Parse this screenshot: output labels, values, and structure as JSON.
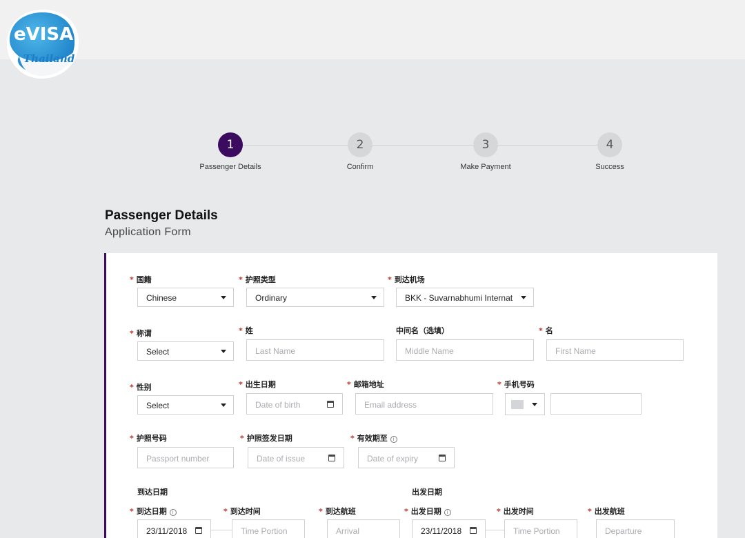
{
  "logo": {
    "line1": "eVISA",
    "line2": "Thailand"
  },
  "stepper": {
    "steps": [
      {
        "number": "1",
        "label": "Passenger Details",
        "active": true
      },
      {
        "number": "2",
        "label": "Confirm",
        "active": false
      },
      {
        "number": "3",
        "label": "Make Payment",
        "active": false
      },
      {
        "number": "4",
        "label": "Success",
        "active": false
      }
    ]
  },
  "page": {
    "title": "Passenger Details",
    "subtitle": "Application Form"
  },
  "form": {
    "nationality": {
      "label": "国籍",
      "value": "Chinese"
    },
    "passport_type": {
      "label": "护照类型",
      "value": "Ordinary"
    },
    "arrival_airport": {
      "label": "到达机场",
      "value": "BKK - Suvarnabhumi Internat"
    },
    "title": {
      "label": "称谓",
      "value": "Select"
    },
    "last_name": {
      "label": "姓",
      "placeholder": "Last Name"
    },
    "middle_name": {
      "label": "中间名（选填）",
      "placeholder": "Middle Name"
    },
    "first_name": {
      "label": "名",
      "placeholder": "First Name"
    },
    "gender": {
      "label": "性别",
      "value": "Select"
    },
    "dob": {
      "label": "出生日期",
      "placeholder": "Date of birth"
    },
    "email": {
      "label": "邮箱地址",
      "placeholder": "Email address"
    },
    "phone": {
      "label": "手机号码"
    },
    "passport_no": {
      "label": "护照号码",
      "placeholder": "Passport number"
    },
    "issue_date": {
      "label": "护照签发日期",
      "placeholder": "Date of issue"
    },
    "expiry_date": {
      "label": "有效期至",
      "placeholder": "Date of expiry"
    },
    "arrival_section": "到达日期",
    "departure_section": "出发日期",
    "arrival_date": {
      "label": "到达日期",
      "value": "23/11/2018"
    },
    "arrival_time": {
      "label": "到达时间",
      "placeholder": "Time Portion"
    },
    "arrival_flight": {
      "label": "到达航班",
      "placeholder": "Arrival"
    },
    "departure_date": {
      "label": "出发日期",
      "value": "23/11/2018"
    },
    "departure_time": {
      "label": "出发时间",
      "placeholder": "Time Portion"
    },
    "departure_flight": {
      "label": "出发航班",
      "placeholder": "Departure"
    }
  },
  "colors": {
    "accent": "#3a0b5e",
    "required": "#c0392b",
    "logo_blue": "#1f8fd6"
  }
}
